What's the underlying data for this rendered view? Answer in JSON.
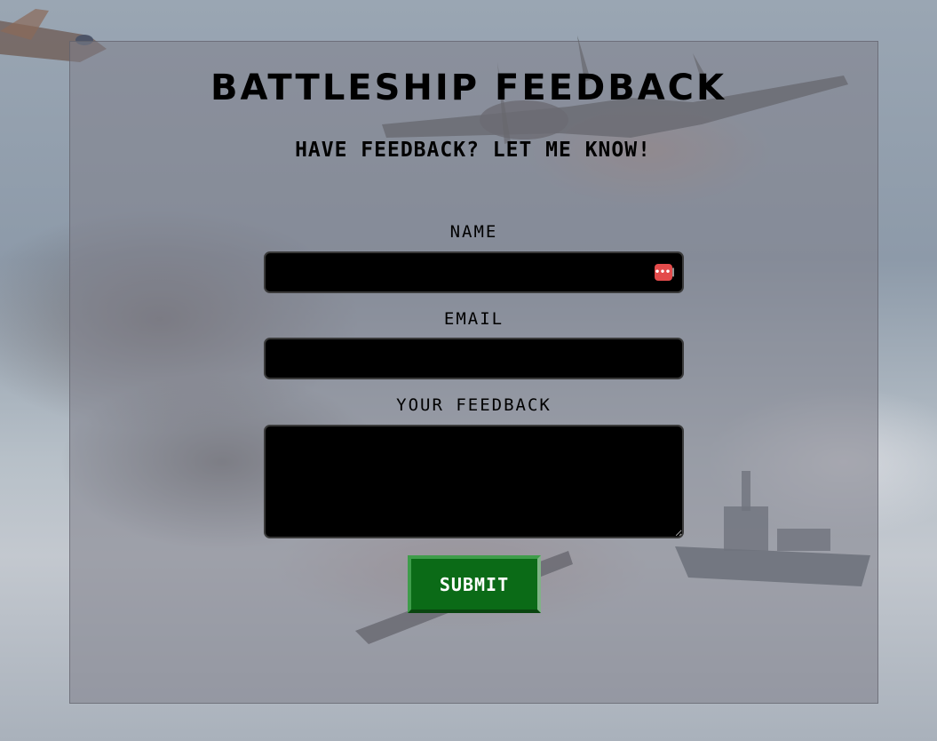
{
  "page": {
    "title": "BATTLESHIP FEEDBACK",
    "subtitle": "HAVE FEEDBACK? LET ME KNOW!"
  },
  "form": {
    "name_label": "NAME",
    "name_value": "",
    "email_label": "EMAIL",
    "email_value": "",
    "feedback_label": "YOUR FEEDBACK",
    "feedback_value": "",
    "submit_label": "SUBMIT",
    "password_manager_icon": "•••|"
  },
  "colors": {
    "submit_bg": "#0b6b17",
    "field_bg": "#000000",
    "panel_overlay": "#80808a"
  }
}
